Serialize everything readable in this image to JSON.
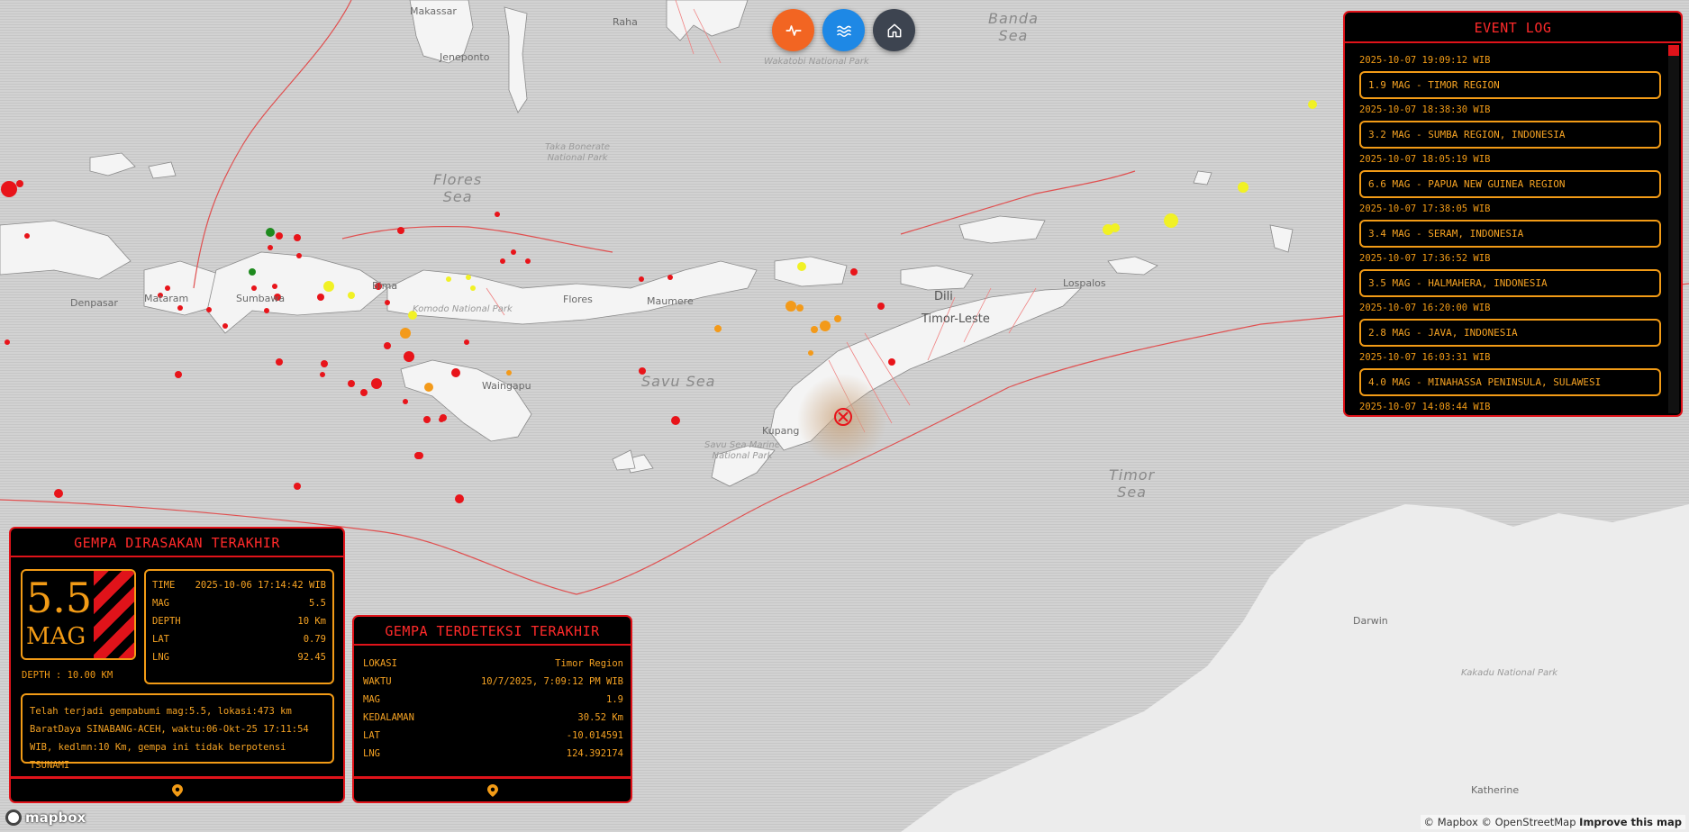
{
  "map": {
    "sea_labels": [
      "Banda\nSea",
      "Flores\nSea",
      "Savu Sea",
      "Timor\nSea"
    ],
    "place_labels": [
      "Makassar",
      "Jeneponto",
      "Raha",
      "Wakatobi National Park",
      "Taka Bonerate\nNational Park",
      "Denpasar",
      "Mataram",
      "Sumbawa",
      "Bima",
      "Flores",
      "Waingapu",
      "Dili",
      "Timor-Leste",
      "Kupang",
      "Savu Sea Marine\nNational Park",
      "Darwin",
      "Kakadu National Park",
      "Katherine",
      "Komodo National Park",
      "Maumere",
      "Lospalos"
    ],
    "colors": {
      "water": "#cfcfcf",
      "land": "#f4f4f4",
      "fault": "#e33a3a",
      "quake_red": "#e8141a",
      "quake_orange": "#f39a1a",
      "quake_yellow": "#f1f125",
      "quake_green": "#1e8a1e"
    }
  },
  "top_buttons": [
    {
      "name": "activity",
      "icon": "activity-icon",
      "color": "#f26522"
    },
    {
      "name": "tsunami",
      "icon": "waves-icon",
      "color": "#1e88e5"
    },
    {
      "name": "home",
      "icon": "home-icon",
      "color": "#3d4450"
    }
  ],
  "event_log": {
    "title": "EVENT LOG",
    "entries": [
      {
        "time": "2025-10-07 19:09:12 WIB",
        "text": "1.9 MAG - TIMOR REGION"
      },
      {
        "time": "2025-10-07 18:38:30 WIB",
        "text": "3.2 MAG - SUMBA REGION, INDONESIA"
      },
      {
        "time": "2025-10-07 18:05:19 WIB",
        "text": "6.6 MAG - PAPUA NEW GUINEA REGION"
      },
      {
        "time": "2025-10-07 17:38:05 WIB",
        "text": "3.4 MAG - SERAM, INDONESIA"
      },
      {
        "time": "2025-10-07 17:36:52 WIB",
        "text": "3.5 MAG - HALMAHERA, INDONESIA"
      },
      {
        "time": "2025-10-07 16:20:00 WIB",
        "text": "2.8 MAG - JAVA, INDONESIA"
      },
      {
        "time": "2025-10-07 16:03:31 WIB",
        "text": "4.0 MAG - MINAHASSA PENINSULA, SULAWESI"
      },
      {
        "time": "2025-10-07 14:08:44 WIB",
        "text": ""
      }
    ]
  },
  "felt": {
    "title": "GEMPA DIRASAKAN TERAKHIR",
    "mag_value": "5.5",
    "mag_unit": "MAG",
    "depth_line": "DEPTH : 10.00 KM",
    "rows": [
      {
        "k": "TIME",
        "v": "2025-10-06 17:14:42 WIB"
      },
      {
        "k": "MAG",
        "v": "5.5"
      },
      {
        "k": "DEPTH",
        "v": "10 Km"
      },
      {
        "k": "LAT",
        "v": "0.79"
      },
      {
        "k": "LNG",
        "v": "92.45"
      }
    ],
    "description": "Telah terjadi gempabumi mag:5.5, lokasi:473 km BaratDaya SINABANG-ACEH, waktu:06-Okt-25 17:11:54 WIB, kedlmn:10 Km, gempa ini tidak berpotensi TSUNAMI"
  },
  "detected": {
    "title": "GEMPA TERDETEKSI TERAKHIR",
    "rows": [
      {
        "k": "LOKASI",
        "v": "Timor Region"
      },
      {
        "k": "WAKTU",
        "v": "10/7/2025, 7:09:12 PM WIB"
      },
      {
        "k": "MAG",
        "v": "1.9"
      },
      {
        "k": "KEDALAMAN",
        "v": "30.52 Km"
      },
      {
        "k": "LAT",
        "v": "-10.014591"
      },
      {
        "k": "LNG",
        "v": "124.392174"
      }
    ]
  },
  "attribution": {
    "mapbox": "© Mapbox",
    "osm": "© OpenStreetMap",
    "improve": "Improve this map"
  },
  "logo_text": "mapbox"
}
